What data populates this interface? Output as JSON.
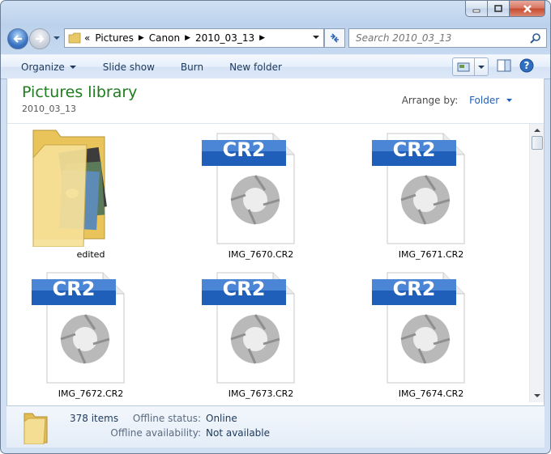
{
  "window": {
    "caption_buttons": {
      "minimize_icon": "minimize-icon",
      "maximize_icon": "maximize-icon",
      "close_icon": "close-icon"
    }
  },
  "nav": {
    "breadcrumbs": [
      "Pictures",
      "Canon",
      "2010_03_13"
    ],
    "overflow_glyph": "«",
    "search_placeholder": "Search 2010_03_13"
  },
  "toolbar": {
    "organize_label": "Organize",
    "slideshow_label": "Slide show",
    "burn_label": "Burn",
    "new_folder_label": "New folder"
  },
  "library": {
    "title": "Pictures library",
    "subtitle": "2010_03_13",
    "arrange_label": "Arrange by:",
    "arrange_value": "Folder"
  },
  "items": [
    {
      "name": "edited",
      "type": "folder"
    },
    {
      "name": "IMG_7670.CR2",
      "type": "cr2",
      "badge": "CR2"
    },
    {
      "name": "IMG_7671.CR2",
      "type": "cr2",
      "badge": "CR2"
    },
    {
      "name": "IMG_7672.CR2",
      "type": "cr2",
      "badge": "CR2"
    },
    {
      "name": "IMG_7673.CR2",
      "type": "cr2",
      "badge": "CR2"
    },
    {
      "name": "IMG_7674.CR2",
      "type": "cr2",
      "badge": "CR2"
    }
  ],
  "details": {
    "count": "378 items",
    "offline_status_label": "Offline status:",
    "offline_status_value": "Online",
    "offline_availability_label": "Offline availability:",
    "offline_availability_value": "Not available"
  },
  "colors": {
    "library_title": "#1e7d1e",
    "badge_blue": "#1f5fb9",
    "toolbar_text": "#1e395b"
  }
}
